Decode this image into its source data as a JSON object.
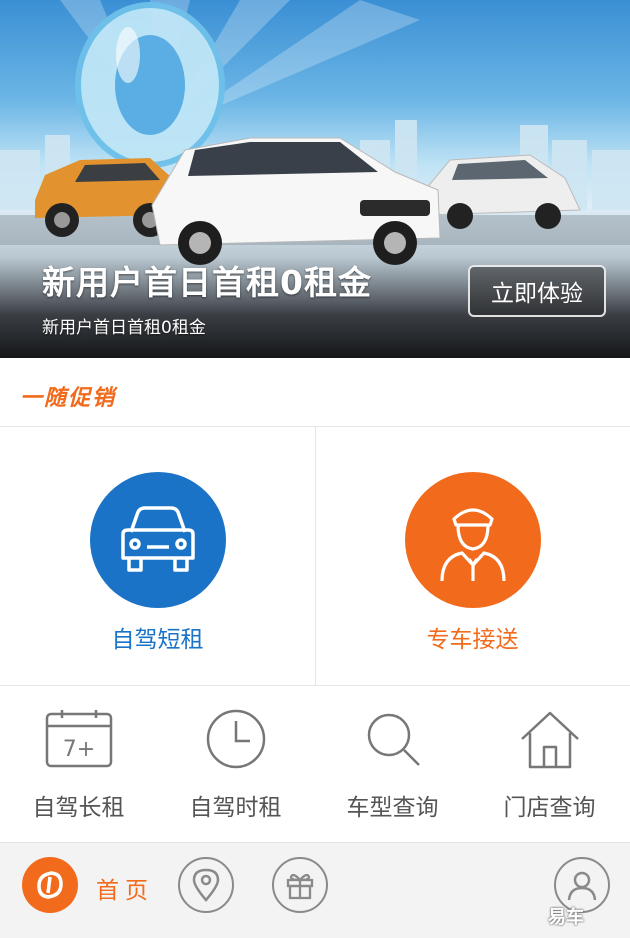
{
  "banner": {
    "title": "新用户首日首租0租金",
    "subtitle": "新用户首日首租0租金",
    "cta_label": "立即体验"
  },
  "promo": {
    "label": "一随促销"
  },
  "services": [
    {
      "label": "自驾短租",
      "icon": "car-icon",
      "color": "#1a73c7"
    },
    {
      "label": "专车接送",
      "icon": "chauffeur-icon",
      "color": "#f26b1d"
    }
  ],
  "tools": [
    {
      "label": "自驾长租",
      "icon": "calendar-7plus-icon",
      "badge": "7+"
    },
    {
      "label": "自驾时租",
      "icon": "clock-icon"
    },
    {
      "label": "车型查询",
      "icon": "search-icon"
    },
    {
      "label": "门店查询",
      "icon": "house-icon"
    }
  ],
  "bottom_nav": {
    "home_label": "首页",
    "items": [
      "home-logo-icon",
      "location-pin-icon",
      "gift-icon",
      "user-icon"
    ]
  },
  "watermark": {
    "text": "易车"
  },
  "colors": {
    "accent_orange": "#f26b1d",
    "accent_blue": "#1a73c7"
  }
}
